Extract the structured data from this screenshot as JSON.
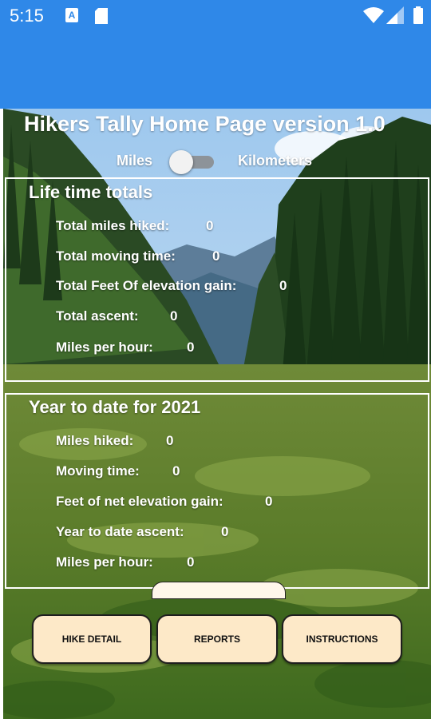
{
  "status": {
    "time": "5:15",
    "a_icon": "A"
  },
  "icons": {
    "a": "a-icon",
    "sd": "sd-card-icon",
    "wifi": "wifi-icon",
    "signal": "signal-icon",
    "battery": "battery-icon"
  },
  "header": {
    "title": "Hikers Tally Home Page version 1.0"
  },
  "units": {
    "miles": "Miles",
    "km": "Kilometers",
    "kilometers_selected": false
  },
  "lifetime": {
    "title": "Life time totals",
    "rows": [
      {
        "label": "Total miles hiked:",
        "value": "0"
      },
      {
        "label": "Total moving time:",
        "value": "0"
      },
      {
        "label": "Total Feet Of elevation gain:",
        "value": "0"
      },
      {
        "label": "Total ascent:",
        "value": "0"
      },
      {
        "label": "Miles per hour:",
        "value": "0"
      }
    ]
  },
  "ytd": {
    "title": "Year to date for 2021",
    "rows": [
      {
        "label": "Miles hiked:",
        "value": "0"
      },
      {
        "label": "Moving time:",
        "value": "0"
      },
      {
        "label": "Feet of net elevation gain:",
        "value": "0"
      },
      {
        "label": "Year to date ascent:",
        "value": "0"
      },
      {
        "label": "Miles per hour:",
        "value": "0"
      }
    ]
  },
  "buttons": {
    "hike_detail": "HIKE DETAIL",
    "reports": "REPORTS",
    "instructions": "INSTRUCTIONS"
  },
  "colors": {
    "app_blue": "#2f88e8",
    "button_fill": "#fde9c8"
  }
}
